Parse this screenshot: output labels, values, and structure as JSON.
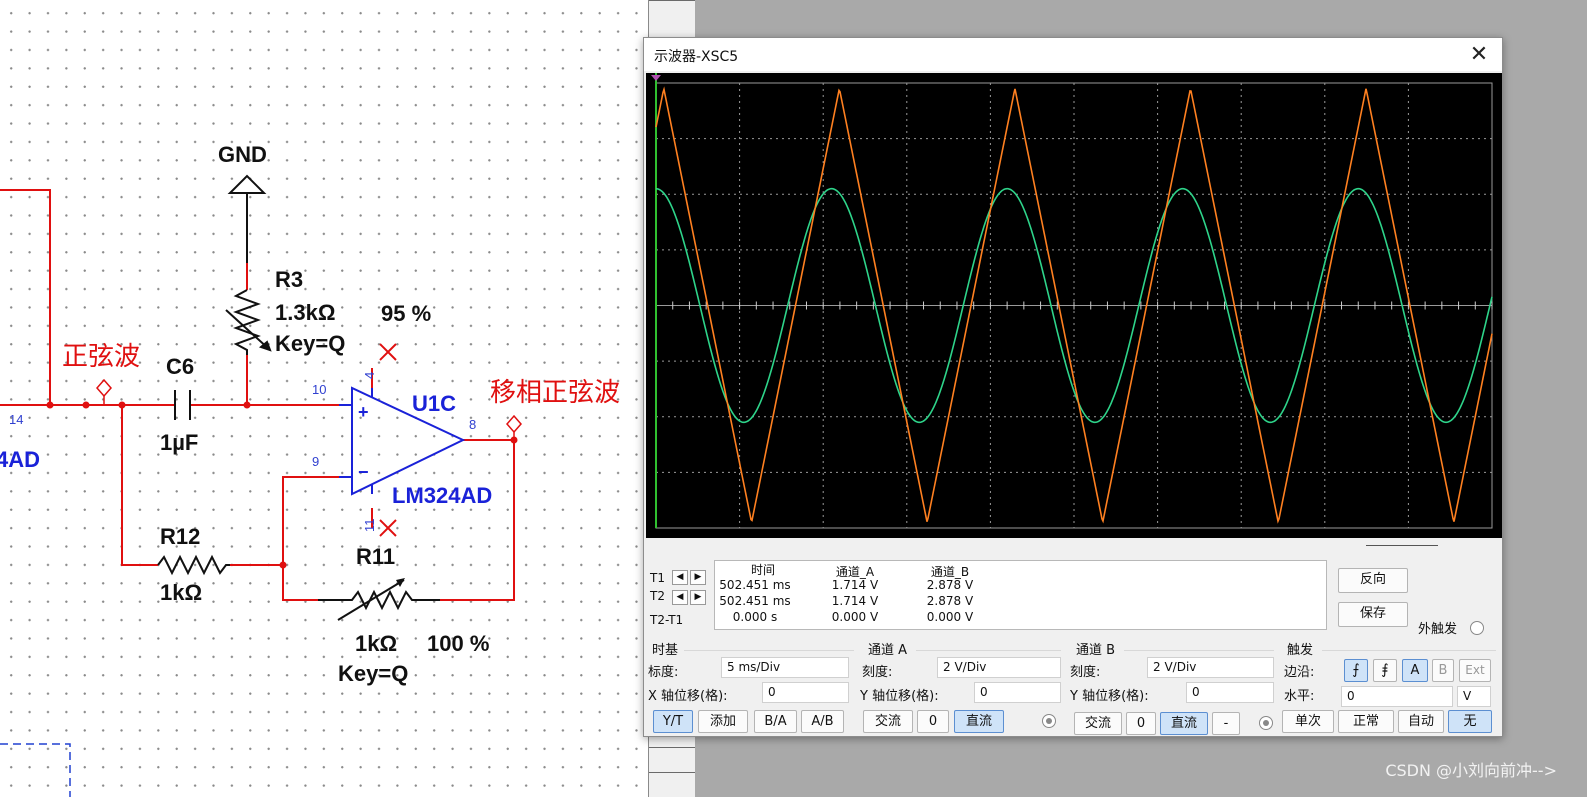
{
  "schematic": {
    "gnd_label": "GND",
    "r3": {
      "name": "R3",
      "value": "1.3kΩ",
      "key": "Key=Q",
      "percent": "95 %"
    },
    "c6": {
      "name": "C6",
      "value": "1µF"
    },
    "u1c": {
      "name": "U1C",
      "part": "LM324AD"
    },
    "left_part_fragment": "4AD",
    "r12": {
      "name": "R12",
      "value": "1kΩ"
    },
    "r11": {
      "name": "R11",
      "value": "1kΩ",
      "percent": "100 %",
      "key": "Key=Q"
    },
    "probe_in_label": "正弦波",
    "probe_out_label": "移相正弦波",
    "pins": {
      "p14": "14",
      "p10": "10",
      "p9": "9",
      "p8": "8",
      "p4": "4",
      "p11": "11",
      "plus": "+",
      "minus": "−"
    }
  },
  "watermark": "CSDN @小刘向前冲-->",
  "window": {
    "title": "示波器-XSC5",
    "close_glyph": "✕"
  },
  "colors": {
    "channel_a": "#2ed48a",
    "channel_b": "#ff8020",
    "grid": "#9a9a9a",
    "screen_bg": "#000000",
    "wire": "#e01010",
    "part_label": "#1a22d8"
  },
  "readout": {
    "headers": [
      "时间",
      "通道_A",
      "通道_B"
    ],
    "rows": [
      {
        "label": "T1",
        "time": "502.451 ms",
        "a": "1.714 V",
        "b": "2.878 V"
      },
      {
        "label": "T2",
        "time": "502.451 ms",
        "a": "1.714 V",
        "b": "2.878 V"
      },
      {
        "label": "T2-T1",
        "time": "0.000 s",
        "a": "0.000 V",
        "b": "0.000 V"
      }
    ],
    "arrow_left": "◀",
    "arrow_right": "▶"
  },
  "side_buttons": {
    "reverse": "反向",
    "save": "保存",
    "ext_trigger": "外触发"
  },
  "timebase": {
    "title": "时基",
    "scale_label": "标度:",
    "scale_value": "5 ms/Div",
    "xpos_label": "X 轴位移(格):",
    "xpos_value": "0",
    "modes": [
      "Y/T",
      "添加",
      "B/A",
      "A/B"
    ],
    "active_mode": "Y/T"
  },
  "channel_a": {
    "title": "通道 A",
    "scale_label": "刻度:",
    "scale_value": "2  V/Div",
    "ypos_label": "Y 轴位移(格):",
    "ypos_value": "0",
    "coupling": [
      "交流",
      "0",
      "直流"
    ],
    "active_coupling": "直流"
  },
  "channel_b": {
    "title": "通道 B",
    "scale_label": "刻度:",
    "scale_value": "2  V/Div",
    "ypos_label": "Y 轴位移(格):",
    "ypos_value": "0",
    "coupling": [
      "交流",
      "0",
      "直流",
      "-"
    ],
    "active_coupling": "直流"
  },
  "trigger": {
    "title": "触发",
    "edge_label": "边沿:",
    "edges": [
      "A",
      "B",
      "Ext"
    ],
    "active_source": "A",
    "level_label": "水平:",
    "level_value": "0",
    "level_unit": "V",
    "modes": [
      "单次",
      "正常",
      "自动",
      "无"
    ],
    "active_mode": "无"
  },
  "chart_data": {
    "type": "line",
    "time_per_div_ms": 5,
    "volts_per_div": 2,
    "x_divisions": 10,
    "y_divisions": 8,
    "grid": true,
    "series": [
      {
        "channel": "A",
        "shape": "sine",
        "color": "#2ed48a",
        "amplitude_div": 2.1,
        "period_div": 2.1,
        "phase_deg": 90
      },
      {
        "channel": "B",
        "shape": "triangle",
        "color": "#ff8020",
        "amplitude_div": 3.9,
        "period_div": 2.1,
        "phase_deg": 74
      }
    ]
  }
}
